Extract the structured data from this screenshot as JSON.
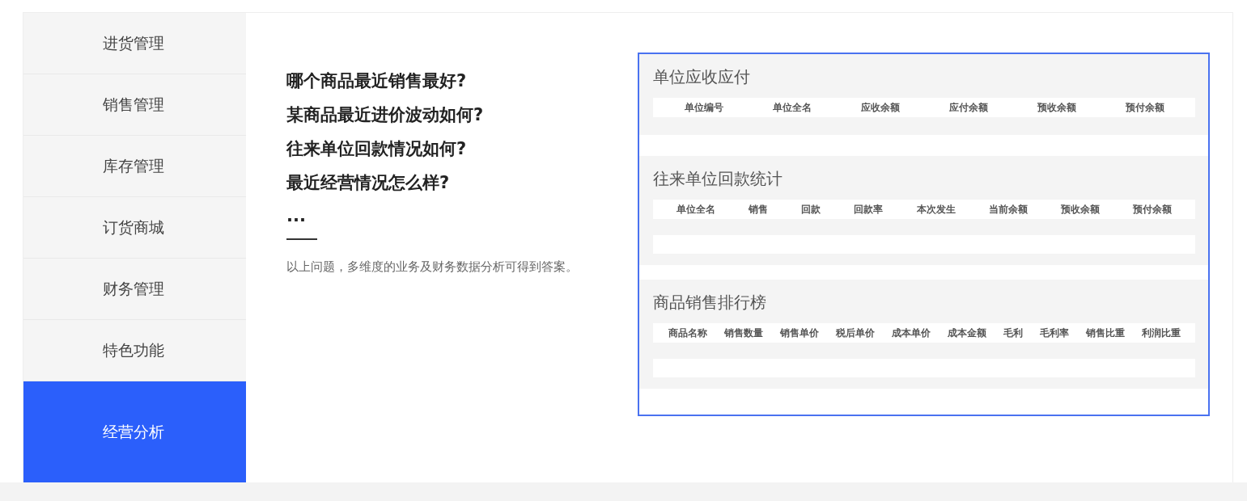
{
  "sidebar": {
    "items": [
      {
        "label": "进货管理",
        "selected": false
      },
      {
        "label": "销售管理",
        "selected": false
      },
      {
        "label": "库存管理",
        "selected": false
      },
      {
        "label": "订货商城",
        "selected": false
      },
      {
        "label": "财务管理",
        "selected": false
      },
      {
        "label": "特色功能",
        "selected": false
      },
      {
        "label": "经营分析",
        "selected": true
      }
    ]
  },
  "content": {
    "questions": [
      "哪个商品最近销售最好?",
      "某商品最近进价波动如何?",
      "往来单位回款情况如何?",
      "最近经营情况怎么样?"
    ],
    "ellipsis": "...",
    "description": "以上问题，多维度的业务及财务数据分析可得到答案。"
  },
  "preview": {
    "sections": [
      {
        "title": "单位应收应付",
        "blank_row": false,
        "columns": [
          "单位编号",
          "单位全名",
          "应收余额",
          "应付余额",
          "预收余额",
          "预付余额"
        ]
      },
      {
        "title": "往来单位回款统计",
        "blank_row": true,
        "columns": [
          "单位全名",
          "销售",
          "回款",
          "回款率",
          "本次发生",
          "当前余额",
          "预收余额",
          "预付余额"
        ]
      },
      {
        "title": "商品销售排行榜",
        "blank_row": true,
        "columns": [
          "商品名称",
          "销售数量",
          "销售单价",
          "税后单价",
          "成本单价",
          "成本金额",
          "毛利",
          "毛利率",
          "销售比重",
          "利润比重"
        ]
      }
    ]
  }
}
